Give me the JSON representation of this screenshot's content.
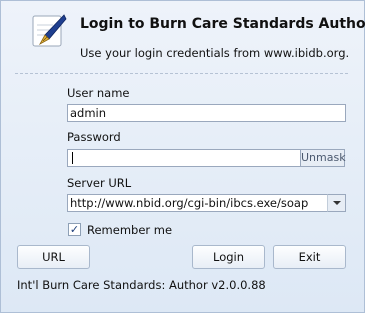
{
  "dialog": {
    "title": "Login to Burn Care Standards Author",
    "subtitle": "Use your login credentials from www.ibidb.org.",
    "icon": "fountain-pen-icon"
  },
  "form": {
    "username_label": "User name",
    "username_value": "admin",
    "password_label": "Password",
    "password_value": "",
    "unmask_label": "Unmask",
    "server_label": "Server URL",
    "server_value": "http://www.nbid.org/cgi-bin/ibcs.exe/soap",
    "remember_label": "Remember me",
    "remember_checked": true
  },
  "buttons": {
    "url": "URL",
    "login": "Login",
    "exit": "Exit"
  },
  "footer": {
    "version": "Int'l Burn Care Standards: Author v2.0.0.88"
  }
}
